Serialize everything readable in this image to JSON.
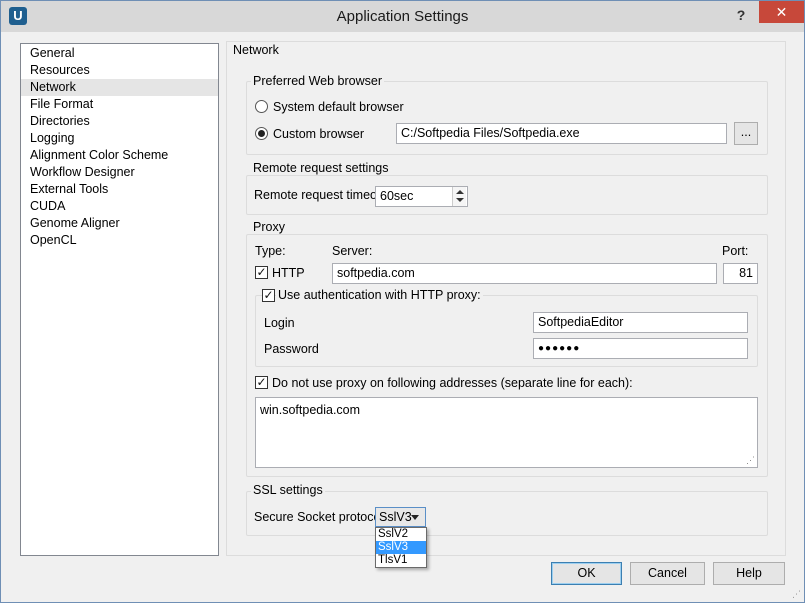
{
  "window": {
    "title": "Application Settings",
    "app_icon": "U",
    "help": "?",
    "close": "✕"
  },
  "sidebar": {
    "items": [
      {
        "label": "General"
      },
      {
        "label": "Resources"
      },
      {
        "label": "Network",
        "selected": true
      },
      {
        "label": "File Format"
      },
      {
        "label": "Directories"
      },
      {
        "label": "Logging"
      },
      {
        "label": "Alignment Color Scheme"
      },
      {
        "label": "Workflow Designer"
      },
      {
        "label": "External Tools"
      },
      {
        "label": "CUDA"
      },
      {
        "label": "Genome Aligner"
      },
      {
        "label": "OpenCL"
      }
    ]
  },
  "section_title": "Network",
  "browser": {
    "group_title": "Preferred Web browser",
    "system_default_label": "System default browser",
    "custom_label": "Custom browser",
    "custom_selected": true,
    "path": "C:/Softpedia Files/Softpedia.exe",
    "browse_label": "..."
  },
  "remote": {
    "group_title": "Remote request settings",
    "timeout_label": "Remote request timeout",
    "timeout_value": "60sec"
  },
  "proxy": {
    "group_title": "Proxy",
    "type_header": "Type:",
    "server_header": "Server:",
    "port_header": "Port:",
    "http_label": "HTTP",
    "http_checked": true,
    "server": "softpedia.com",
    "port": "81",
    "auth_label": "Use authentication with HTTP proxy:",
    "auth_checked": true,
    "login_label": "Login",
    "login_value": "SoftpediaEditor",
    "password_label": "Password",
    "password_value": "●●●●●●",
    "exclude_label": "Do not use proxy on following addresses (separate line for each):",
    "exclude_checked": true,
    "exclude_text": "win.softpedia.com"
  },
  "ssl": {
    "group_title": "SSL settings",
    "protocol_label": "Secure Socket protocol:",
    "protocol_value": "SslV3",
    "options": [
      "SslV2",
      "SslV3",
      "TlsV1"
    ],
    "selected_index": 1
  },
  "buttons": {
    "ok": "OK",
    "cancel": "Cancel",
    "help": "Help"
  },
  "colors": {
    "selection": "#3399ff",
    "close_button": "#c7483a",
    "default_button_border": "#3c7fb1"
  },
  "icons": {
    "check": "✓",
    "grip": "⋰"
  }
}
